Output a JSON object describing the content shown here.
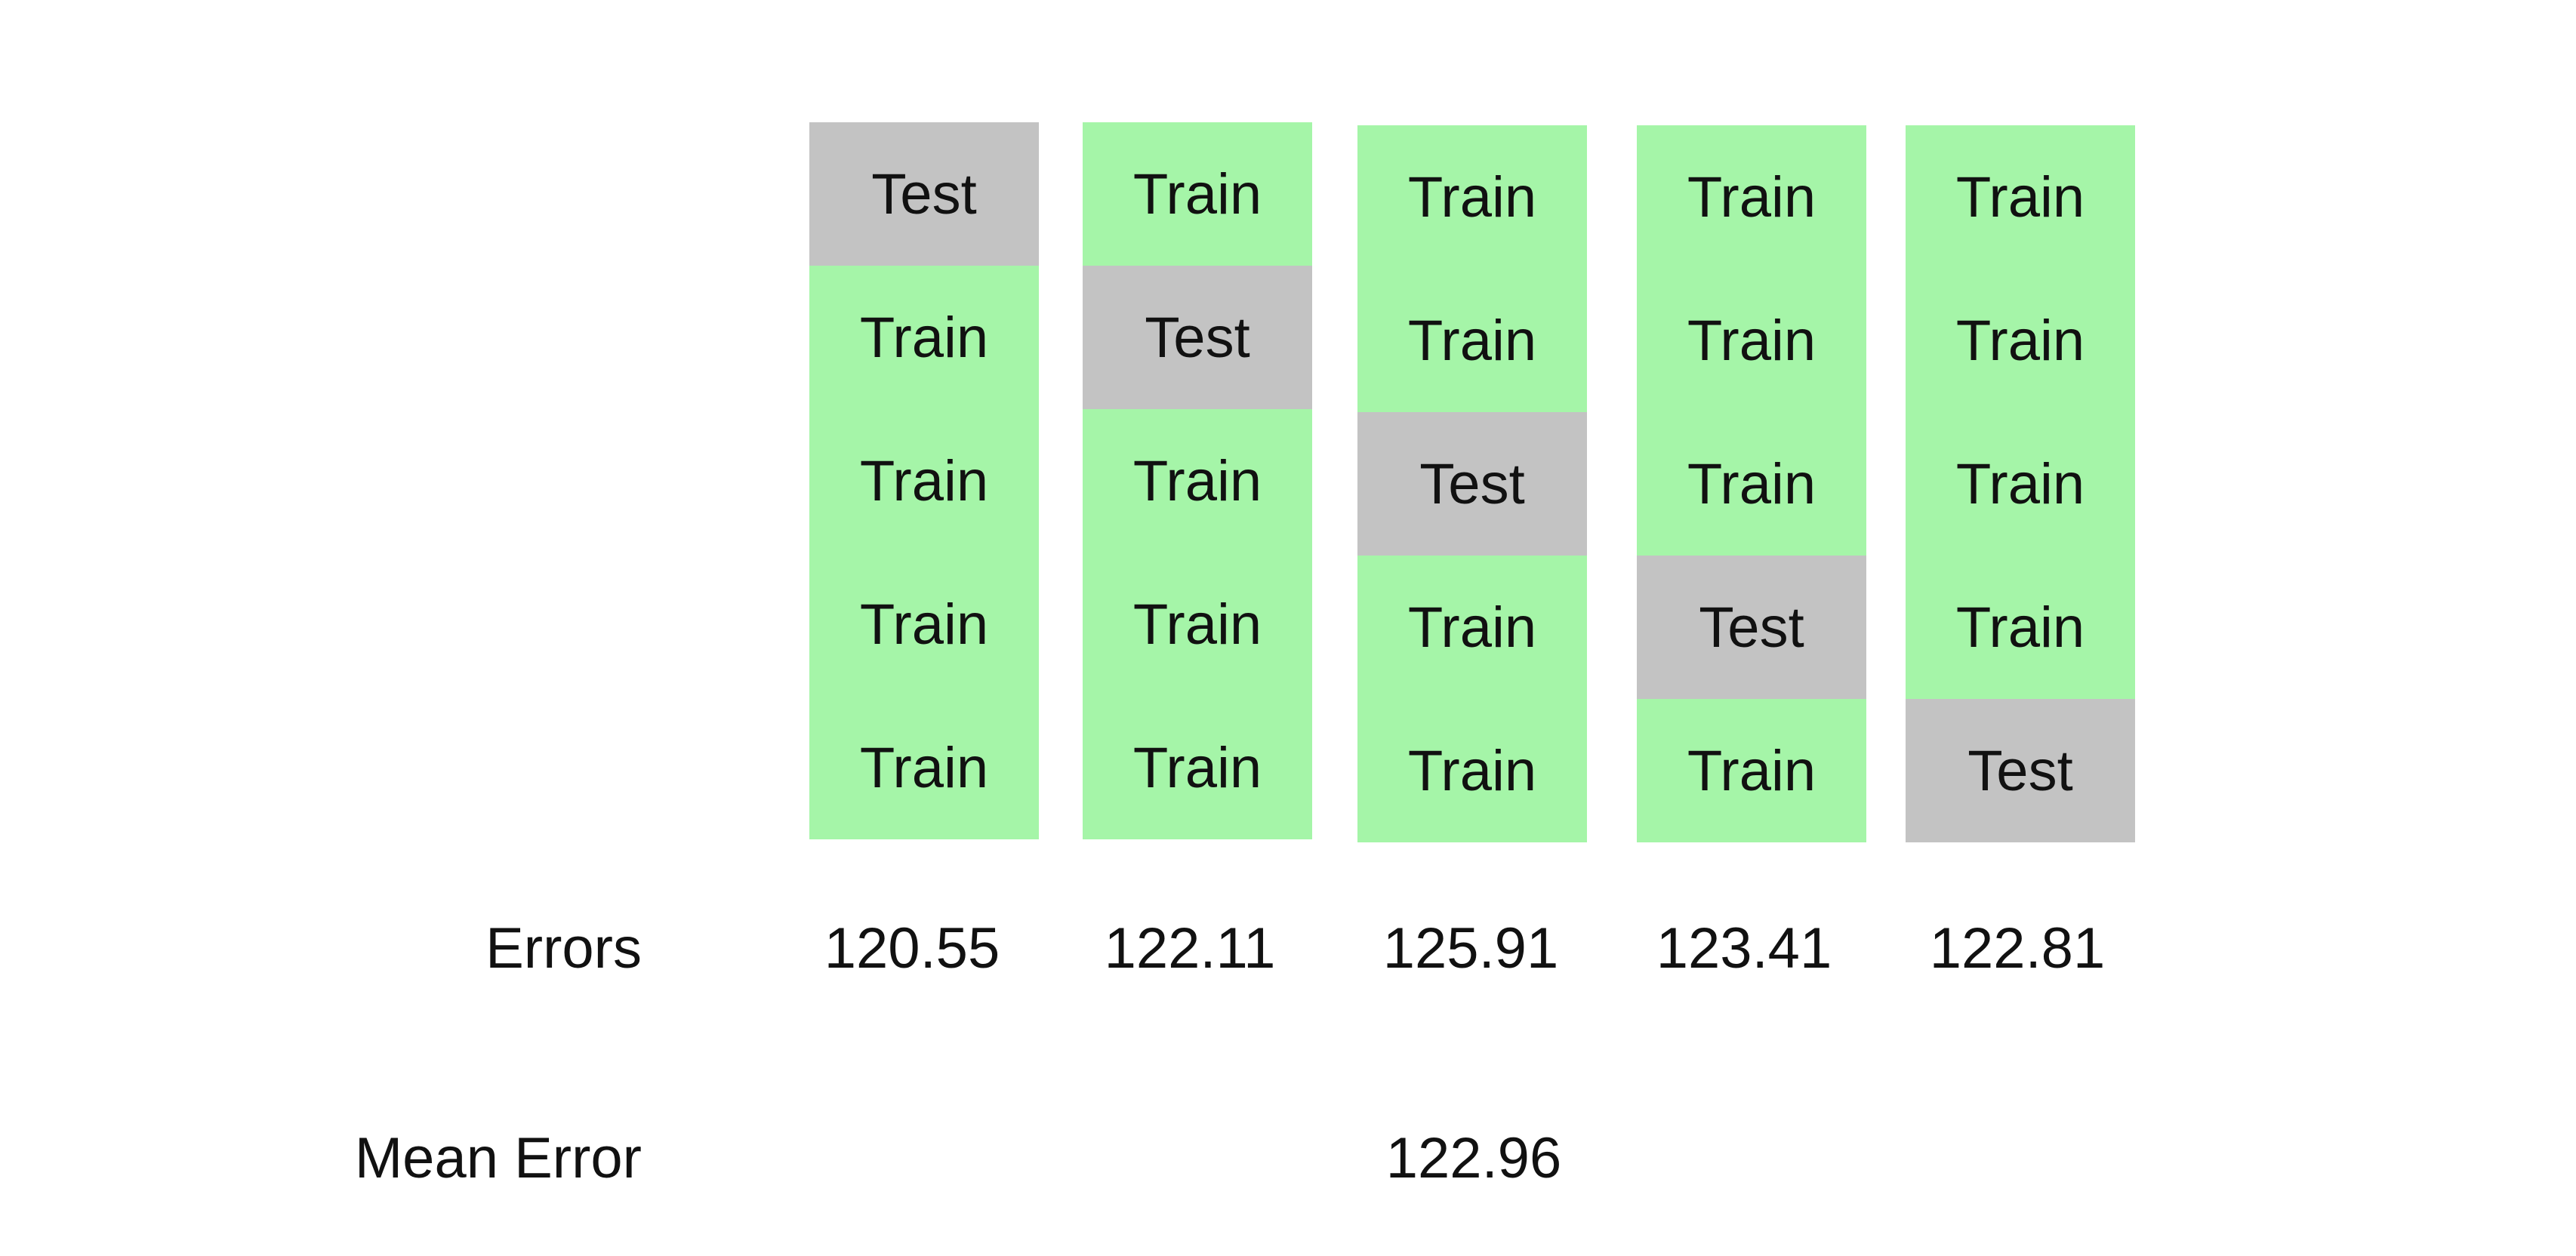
{
  "folds": [
    {
      "cells": [
        "Test",
        "Train",
        "Train",
        "Train",
        "Train"
      ],
      "error": "120.55"
    },
    {
      "cells": [
        "Train",
        "Test",
        "Train",
        "Train",
        "Train"
      ],
      "error": "122.11"
    },
    {
      "cells": [
        "Train",
        "Train",
        "Test",
        "Train",
        "Train"
      ],
      "error": "125.91"
    },
    {
      "cells": [
        "Train",
        "Train",
        "Train",
        "Test",
        "Train"
      ],
      "error": "123.41"
    },
    {
      "cells": [
        "Train",
        "Train",
        "Train",
        "Train",
        "Test"
      ],
      "error": "122.81"
    }
  ],
  "labels": {
    "errors": "Errors",
    "mean_error": "Mean Error"
  },
  "mean_error_value": "122.96",
  "colors": {
    "train": "#a5f5a8",
    "test": "#c3c3c3"
  }
}
